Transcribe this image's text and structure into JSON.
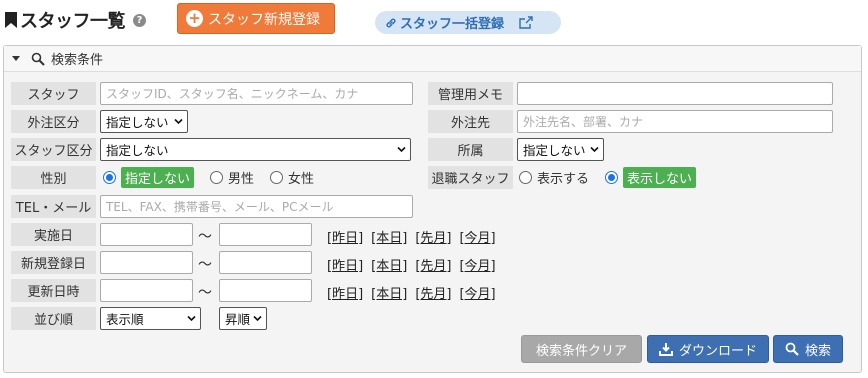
{
  "header": {
    "title": "スタッフ一覧",
    "help": "?",
    "new_button": "スタッフ新規登録",
    "bulk_button": "スタッフ一括登録"
  },
  "panel": {
    "title": "検索条件"
  },
  "fields": {
    "staff": {
      "label": "スタッフ",
      "placeholder": "スタッフID、スタッフ名、ニックネーム、カナ"
    },
    "memo": {
      "label": "管理用メモ",
      "value": ""
    },
    "outsource_type": {
      "label": "外注区分",
      "value": "指定しない"
    },
    "outsource_to": {
      "label": "外注先",
      "placeholder": "外注先名、部署、カナ"
    },
    "staff_type": {
      "label": "スタッフ区分",
      "value": "指定しない"
    },
    "affiliation": {
      "label": "所属",
      "value": "指定しない"
    },
    "gender": {
      "label": "性別",
      "options": [
        "指定しない",
        "男性",
        "女性"
      ],
      "selected": "指定しない"
    },
    "retired": {
      "label": "退職スタッフ",
      "options": [
        "表示する",
        "表示しない"
      ],
      "selected": "表示しない"
    },
    "contact": {
      "label": "TEL・メール",
      "placeholder": "TEL、FAX、携帯番号、メール、PCメール"
    },
    "date_implemented": {
      "label": "実施日"
    },
    "date_registered": {
      "label": "新規登録日"
    },
    "date_updated": {
      "label": "更新日時"
    },
    "sort": {
      "label": "並び順",
      "value": "表示順",
      "order": "昇順"
    }
  },
  "range_sep": "～",
  "quick_links": [
    "[昨日]",
    "[本日]",
    "[先月]",
    "[今月]"
  ],
  "buttons": {
    "clear": "検索条件クリア",
    "download": "ダウンロード",
    "search": "検索"
  },
  "colors": {
    "new_button": "#f07a3a",
    "bulk_button_bg": "#d6e5f5",
    "primary": "#3f6fb3",
    "chip": "#4caf50"
  }
}
